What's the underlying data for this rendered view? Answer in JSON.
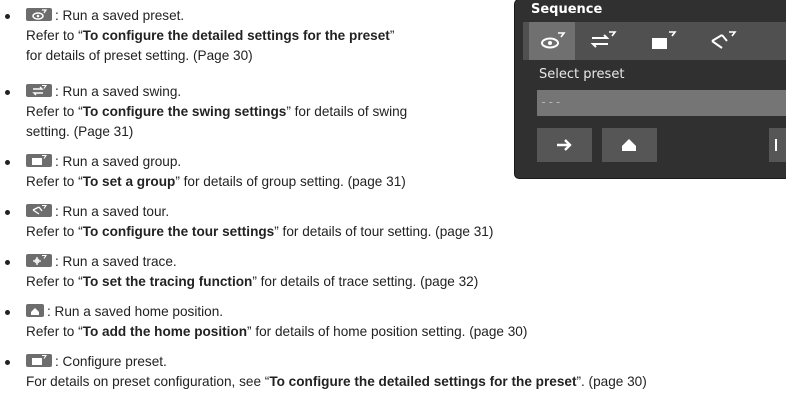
{
  "items": [
    {
      "icon": "preset-icon",
      "desc": ": Run a saved preset.",
      "ref_prefix": "Refer to “",
      "ref_bold": "To configure the detailed settings for the preset",
      "ref_suffix": "”",
      "cont": "for details of preset setting. (Page 30)"
    },
    {
      "icon": "swing-icon",
      "desc": ": Run a saved swing.",
      "ref_prefix": "Refer to “",
      "ref_bold": "To configure the swing settings",
      "ref_suffix": "” for details of swing",
      "cont": "setting. (Page 31)"
    },
    {
      "icon": "group-icon",
      "desc": ": Run a saved group.",
      "ref_prefix": "Refer to “",
      "ref_bold": "To set a group",
      "ref_suffix": "” for details of group setting. (page 31)"
    },
    {
      "icon": "tour-icon",
      "desc": ": Run a saved tour.",
      "ref_prefix": "Refer to “",
      "ref_bold": "To configure the tour settings",
      "ref_suffix": "” for details of tour setting. (page 31)"
    },
    {
      "icon": "trace-icon",
      "desc": ": Run a saved trace.",
      "ref_prefix": "Refer to “",
      "ref_bold": "To set the tracing function",
      "ref_suffix": "” for details of trace setting. (page 32)"
    },
    {
      "icon": "home-icon",
      "desc": ": Run a saved home position.",
      "ref_prefix": "Refer to “",
      "ref_bold": "To add the home position",
      "ref_suffix": "” for details of home position setting. (page 30)"
    },
    {
      "icon": "configure-preset-icon",
      "desc": ": Configure preset.",
      "ref_prefix": "For details on preset configuration, see “",
      "ref_bold": "To configure the detailed settings for the preset",
      "ref_suffix": "”. (page 30)"
    }
  ],
  "panel": {
    "title": "Sequence",
    "select_label": "Select preset",
    "select_value": "---",
    "icons": [
      "preset-icon",
      "swing-icon",
      "group-icon",
      "tour-icon"
    ],
    "buttons": [
      "arrow-right-icon",
      "home-icon"
    ]
  },
  "colors": {
    "panel_bg": "#303030",
    "icon_bar": "#505050",
    "icon_chip": "#6d6d6d"
  }
}
